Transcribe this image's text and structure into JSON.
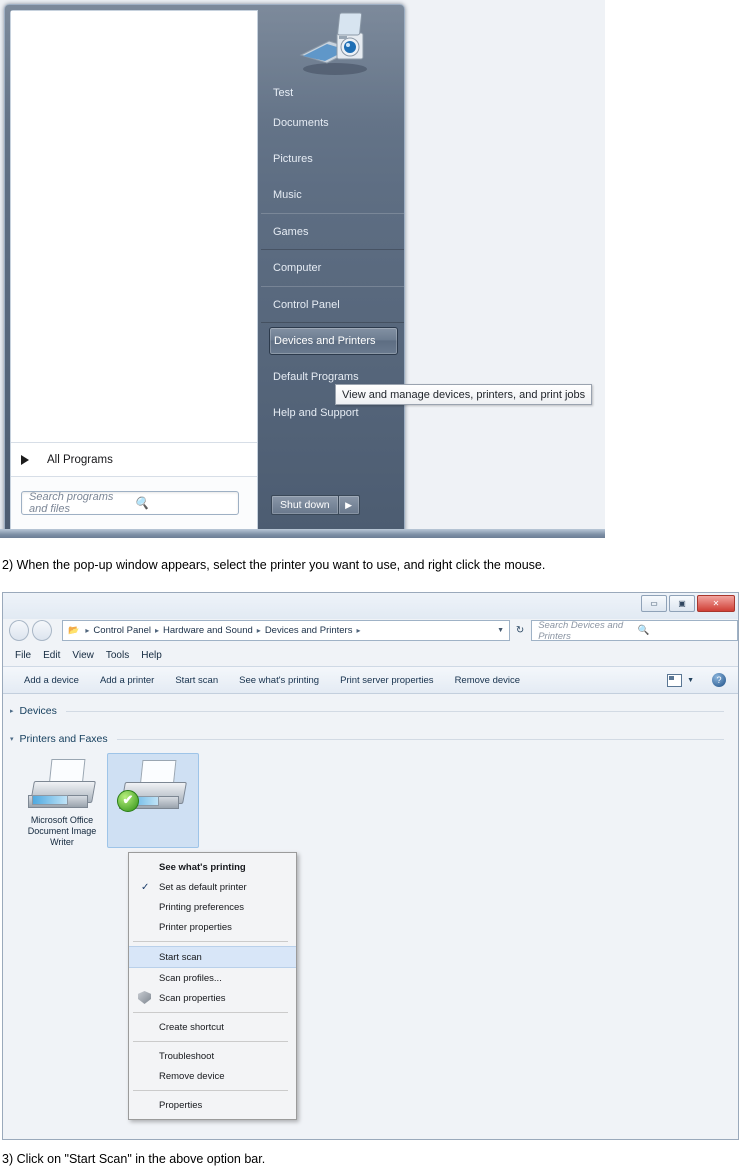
{
  "figure1": {
    "start_menu": {
      "user_name": "Test",
      "avatar_icon": "scanner-camera-avatar",
      "right_items": [
        {
          "label": "Documents"
        },
        {
          "label": "Pictures"
        },
        {
          "label": "Music"
        },
        {
          "label": "Games"
        },
        {
          "label": "Computer"
        },
        {
          "label": "Control Panel"
        },
        {
          "label": "Devices and Printers"
        },
        {
          "label": "Default Programs"
        },
        {
          "label": "Help and Support"
        }
      ],
      "all_programs_label": "All Programs",
      "all_programs_icon": "chevron-right-icon",
      "search_placeholder": "Search programs and files",
      "search_icon": "search-icon",
      "shutdown_label": "Shut down",
      "shutdown_arrow_icon": "chevron-right-icon",
      "tooltip_text": "View and manage devices, printers, and print jobs",
      "selected_item": "Devices and Printers"
    }
  },
  "caption2": "2) When the pop-up window appears, select the printer you want to use, and right click the mouse.",
  "caption3": "3) Click on \"Start Scan\" in the above option bar.",
  "figure2": {
    "window_controls": {
      "minimize_icon": "minimize-icon",
      "maximize_icon": "maximize-icon",
      "close_icon": "close-icon",
      "minimize_glyph": "▭",
      "maximize_glyph": "▣",
      "close_glyph": "✕"
    },
    "nav": {
      "back_icon": "back-arrow-icon",
      "forward_icon": "forward-arrow-icon",
      "folder_icon": "folder-icon",
      "breadcrumbs": [
        "Control Panel",
        "Hardware and Sound",
        "Devices and Printers"
      ],
      "breadcrumb_separator": "▸",
      "history_dropdown_icon": "chevron-down-icon",
      "refresh_icon": "refresh-icon",
      "refresh_glyph": "↻",
      "search_placeholder": "Search Devices and Printers",
      "search_icon": "search-icon"
    },
    "menubar": [
      "File",
      "Edit",
      "View",
      "Tools",
      "Help"
    ],
    "command_bar": {
      "items": [
        "Add a device",
        "Add a printer",
        "Start scan",
        "See what's printing",
        "Print server properties",
        "Remove device"
      ],
      "view_icon": "view-layout-icon",
      "view_dropdown_icon": "chevron-down-icon",
      "help_icon": "help-icon",
      "help_glyph": "?"
    },
    "sections": [
      {
        "name": "Devices",
        "expanded": false,
        "arrow": "▸"
      },
      {
        "name": "Printers and Faxes",
        "expanded": true,
        "arrow": "▾"
      }
    ],
    "devices": [
      {
        "name": "Microsoft Office Document Image Writer",
        "icon": "printer-icon",
        "selected": false,
        "default": false
      },
      {
        "name": "",
        "icon": "printer-icon",
        "selected": true,
        "default": true,
        "badge_icon": "green-check-badge-icon",
        "badge_glyph": "✔"
      }
    ],
    "context_menu": {
      "items": [
        {
          "label": "See what's printing",
          "bold": true,
          "checked": false,
          "highlighted": false
        },
        {
          "label": "Set as default printer",
          "bold": false,
          "checked": true,
          "check_glyph": "✓",
          "highlighted": false
        },
        {
          "label": "Printing preferences",
          "bold": false,
          "checked": false,
          "highlighted": false
        },
        {
          "label": "Printer properties",
          "bold": false,
          "checked": false,
          "highlighted": false
        },
        {
          "separator": true
        },
        {
          "label": "Start scan",
          "bold": false,
          "checked": false,
          "highlighted": true
        },
        {
          "label": "Scan profiles...",
          "bold": false,
          "checked": false,
          "highlighted": false
        },
        {
          "label": "Scan properties",
          "bold": false,
          "checked": false,
          "highlighted": false,
          "icon": "shield-icon"
        },
        {
          "separator": true
        },
        {
          "label": "Create shortcut",
          "bold": false,
          "checked": false,
          "highlighted": false
        },
        {
          "separator": true
        },
        {
          "label": "Troubleshoot",
          "bold": false,
          "checked": false,
          "highlighted": false
        },
        {
          "label": "Remove device",
          "bold": false,
          "checked": false,
          "highlighted": false
        },
        {
          "separator": true
        },
        {
          "label": "Properties",
          "bold": false,
          "checked": false,
          "highlighted": false
        }
      ]
    }
  },
  "colors": {
    "accent": "#2e5f9e",
    "selection": "#cfe0f3",
    "menu_highlight": "#d8e6f8",
    "close_button": "#cf3f35",
    "green_badge": "#2f9016"
  }
}
